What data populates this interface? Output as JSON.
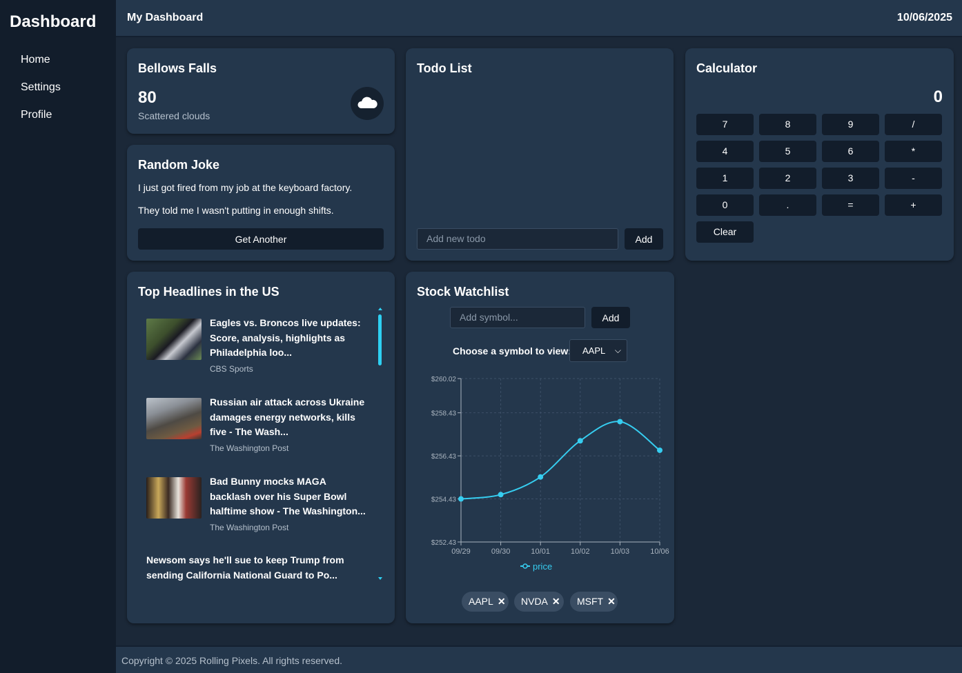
{
  "sidebar": {
    "brand": "Dashboard",
    "items": [
      {
        "label": "Home"
      },
      {
        "label": "Settings"
      },
      {
        "label": "Profile"
      }
    ]
  },
  "header": {
    "title": "My Dashboard",
    "date": "10/06/2025"
  },
  "weather": {
    "city": "Bellows Falls",
    "temp": "80",
    "description": "Scattered clouds",
    "icon": "cloud-icon"
  },
  "joke": {
    "title": "Random Joke",
    "setup": "I just got fired from my job at the keyboard factory.",
    "punchline": "They told me I wasn't putting in enough shifts.",
    "button": "Get Another"
  },
  "todo": {
    "title": "Todo List",
    "placeholder": "Add new todo",
    "add_label": "Add"
  },
  "calculator": {
    "title": "Calculator",
    "display": "0",
    "keys": [
      "7",
      "8",
      "9",
      "/",
      "4",
      "5",
      "6",
      "*",
      "1",
      "2",
      "3",
      "-",
      "0",
      ".",
      "=",
      "+"
    ],
    "clear_label": "Clear"
  },
  "news": {
    "title": "Top Headlines in the US",
    "items": [
      {
        "title": "Eagles vs. Broncos live updates: Score, analysis, highlights as Philadelphia loo...",
        "source": "CBS Sports"
      },
      {
        "title": "Russian air attack across Ukraine damages energy networks, kills five - The Wash...",
        "source": "The Washington Post"
      },
      {
        "title": "Bad Bunny mocks MAGA backlash over his Super Bowl halftime show - The Washington...",
        "source": "The Washington Post"
      },
      {
        "title": "Newsom says he'll sue to keep Trump from sending California National Guard to Po..."
      }
    ]
  },
  "stocks": {
    "title": "Stock Watchlist",
    "placeholder": "Add symbol...",
    "add_label": "Add",
    "choose_label": "Choose a symbol to view:",
    "selected": "AAPL",
    "chips": [
      {
        "label": "AAPL"
      },
      {
        "label": "NVDA"
      },
      {
        "label": "MSFT"
      }
    ]
  },
  "chart_data": {
    "type": "line",
    "x": [
      "09/29",
      "09/30",
      "10/01",
      "10/02",
      "10/03",
      "10/06"
    ],
    "series": [
      {
        "name": "price",
        "values": [
          254.43,
          254.63,
          255.45,
          257.13,
          258.02,
          256.69
        ],
        "color": "#36cdf0"
      }
    ],
    "ylim": [
      252.43,
      260.02
    ],
    "y_ticks": [
      "$260.02",
      "$258.43",
      "$256.43",
      "$254.43",
      "$252.43"
    ],
    "y_tick_values": [
      260.02,
      258.43,
      256.43,
      254.43,
      252.43
    ],
    "grid": true,
    "legend": "bottom"
  },
  "footer": {
    "text": "Copyright © 2025 Rolling Pixels. All rights reserved."
  },
  "colors": {
    "accent": "#36cdf0",
    "card": "#24374c",
    "background": "#1b2838",
    "sidebar": "#121d2b"
  }
}
